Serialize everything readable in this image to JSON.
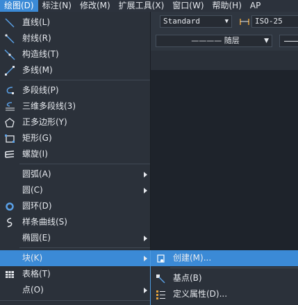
{
  "menubar": [
    {
      "label": "绘图(D)",
      "active": true
    },
    {
      "label": "标注(N)"
    },
    {
      "label": "修改(M)"
    },
    {
      "label": "扩展工具(X)"
    },
    {
      "label": "窗口(W)"
    },
    {
      "label": "帮助(H)"
    },
    {
      "label": "AP"
    }
  ],
  "toolbar": {
    "text_style": "Standard",
    "dim_style": "ISO-25",
    "linetype": "———— 随层"
  },
  "draw_menu": {
    "items": [
      {
        "label": "直线(L)",
        "icon": "line-icon"
      },
      {
        "label": "射线(R)",
        "icon": "ray-icon"
      },
      {
        "label": "构造线(T)",
        "icon": "construction-line-icon"
      },
      {
        "label": "多线(M)",
        "icon": "multiline-icon"
      },
      {
        "label": "多段线(P)",
        "icon": "polyline-icon"
      },
      {
        "label": "三维多段线(3)",
        "icon": "3d-polyline-icon"
      },
      {
        "label": "正多边形(Y)",
        "icon": "polygon-icon"
      },
      {
        "label": "矩形(G)",
        "icon": "rectangle-icon"
      },
      {
        "label": "螺旋(I)",
        "icon": "helix-icon"
      },
      {
        "label": "圆弧(A)"
      },
      {
        "label": "圆(C)"
      },
      {
        "label": "圆环(D)",
        "icon": "donut-icon"
      },
      {
        "label": "样条曲线(S)",
        "icon": "spline-icon"
      },
      {
        "label": "椭圆(E)"
      },
      {
        "label": "块(K)"
      },
      {
        "label": "表格(T)",
        "icon": "table-icon"
      },
      {
        "label": "点(O)"
      }
    ]
  },
  "block_submenu": {
    "items": [
      {
        "label": "创建(M)...",
        "icon": "create-block-icon"
      },
      {
        "label": "基点(B)",
        "icon": "base-point-icon"
      },
      {
        "label": "定义属性(D)...",
        "icon": "define-attribute-icon"
      }
    ]
  },
  "colors": {
    "accent": "#3b8ad6",
    "menu_bg": "#2b313a",
    "canvas_bg": "#1e232b"
  }
}
